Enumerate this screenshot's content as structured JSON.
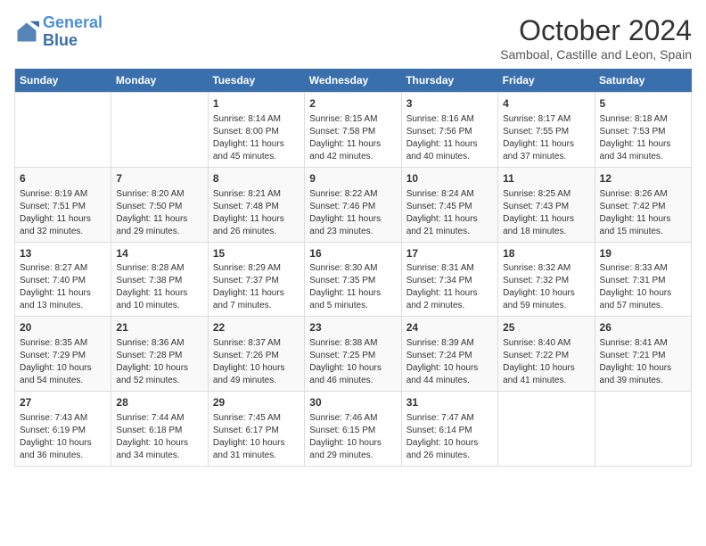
{
  "header": {
    "logo_line1": "General",
    "logo_line2": "Blue",
    "month": "October 2024",
    "location": "Samboal, Castille and Leon, Spain"
  },
  "weekdays": [
    "Sunday",
    "Monday",
    "Tuesday",
    "Wednesday",
    "Thursday",
    "Friday",
    "Saturday"
  ],
  "weeks": [
    [
      {
        "day": "",
        "info": ""
      },
      {
        "day": "",
        "info": ""
      },
      {
        "day": "1",
        "info": "Sunrise: 8:14 AM\nSunset: 8:00 PM\nDaylight: 11 hours and 45 minutes."
      },
      {
        "day": "2",
        "info": "Sunrise: 8:15 AM\nSunset: 7:58 PM\nDaylight: 11 hours and 42 minutes."
      },
      {
        "day": "3",
        "info": "Sunrise: 8:16 AM\nSunset: 7:56 PM\nDaylight: 11 hours and 40 minutes."
      },
      {
        "day": "4",
        "info": "Sunrise: 8:17 AM\nSunset: 7:55 PM\nDaylight: 11 hours and 37 minutes."
      },
      {
        "day": "5",
        "info": "Sunrise: 8:18 AM\nSunset: 7:53 PM\nDaylight: 11 hours and 34 minutes."
      }
    ],
    [
      {
        "day": "6",
        "info": "Sunrise: 8:19 AM\nSunset: 7:51 PM\nDaylight: 11 hours and 32 minutes."
      },
      {
        "day": "7",
        "info": "Sunrise: 8:20 AM\nSunset: 7:50 PM\nDaylight: 11 hours and 29 minutes."
      },
      {
        "day": "8",
        "info": "Sunrise: 8:21 AM\nSunset: 7:48 PM\nDaylight: 11 hours and 26 minutes."
      },
      {
        "day": "9",
        "info": "Sunrise: 8:22 AM\nSunset: 7:46 PM\nDaylight: 11 hours and 23 minutes."
      },
      {
        "day": "10",
        "info": "Sunrise: 8:24 AM\nSunset: 7:45 PM\nDaylight: 11 hours and 21 minutes."
      },
      {
        "day": "11",
        "info": "Sunrise: 8:25 AM\nSunset: 7:43 PM\nDaylight: 11 hours and 18 minutes."
      },
      {
        "day": "12",
        "info": "Sunrise: 8:26 AM\nSunset: 7:42 PM\nDaylight: 11 hours and 15 minutes."
      }
    ],
    [
      {
        "day": "13",
        "info": "Sunrise: 8:27 AM\nSunset: 7:40 PM\nDaylight: 11 hours and 13 minutes."
      },
      {
        "day": "14",
        "info": "Sunrise: 8:28 AM\nSunset: 7:38 PM\nDaylight: 11 hours and 10 minutes."
      },
      {
        "day": "15",
        "info": "Sunrise: 8:29 AM\nSunset: 7:37 PM\nDaylight: 11 hours and 7 minutes."
      },
      {
        "day": "16",
        "info": "Sunrise: 8:30 AM\nSunset: 7:35 PM\nDaylight: 11 hours and 5 minutes."
      },
      {
        "day": "17",
        "info": "Sunrise: 8:31 AM\nSunset: 7:34 PM\nDaylight: 11 hours and 2 minutes."
      },
      {
        "day": "18",
        "info": "Sunrise: 8:32 AM\nSunset: 7:32 PM\nDaylight: 10 hours and 59 minutes."
      },
      {
        "day": "19",
        "info": "Sunrise: 8:33 AM\nSunset: 7:31 PM\nDaylight: 10 hours and 57 minutes."
      }
    ],
    [
      {
        "day": "20",
        "info": "Sunrise: 8:35 AM\nSunset: 7:29 PM\nDaylight: 10 hours and 54 minutes."
      },
      {
        "day": "21",
        "info": "Sunrise: 8:36 AM\nSunset: 7:28 PM\nDaylight: 10 hours and 52 minutes."
      },
      {
        "day": "22",
        "info": "Sunrise: 8:37 AM\nSunset: 7:26 PM\nDaylight: 10 hours and 49 minutes."
      },
      {
        "day": "23",
        "info": "Sunrise: 8:38 AM\nSunset: 7:25 PM\nDaylight: 10 hours and 46 minutes."
      },
      {
        "day": "24",
        "info": "Sunrise: 8:39 AM\nSunset: 7:24 PM\nDaylight: 10 hours and 44 minutes."
      },
      {
        "day": "25",
        "info": "Sunrise: 8:40 AM\nSunset: 7:22 PM\nDaylight: 10 hours and 41 minutes."
      },
      {
        "day": "26",
        "info": "Sunrise: 8:41 AM\nSunset: 7:21 PM\nDaylight: 10 hours and 39 minutes."
      }
    ],
    [
      {
        "day": "27",
        "info": "Sunrise: 7:43 AM\nSunset: 6:19 PM\nDaylight: 10 hours and 36 minutes."
      },
      {
        "day": "28",
        "info": "Sunrise: 7:44 AM\nSunset: 6:18 PM\nDaylight: 10 hours and 34 minutes."
      },
      {
        "day": "29",
        "info": "Sunrise: 7:45 AM\nSunset: 6:17 PM\nDaylight: 10 hours and 31 minutes."
      },
      {
        "day": "30",
        "info": "Sunrise: 7:46 AM\nSunset: 6:15 PM\nDaylight: 10 hours and 29 minutes."
      },
      {
        "day": "31",
        "info": "Sunrise: 7:47 AM\nSunset: 6:14 PM\nDaylight: 10 hours and 26 minutes."
      },
      {
        "day": "",
        "info": ""
      },
      {
        "day": "",
        "info": ""
      }
    ]
  ]
}
